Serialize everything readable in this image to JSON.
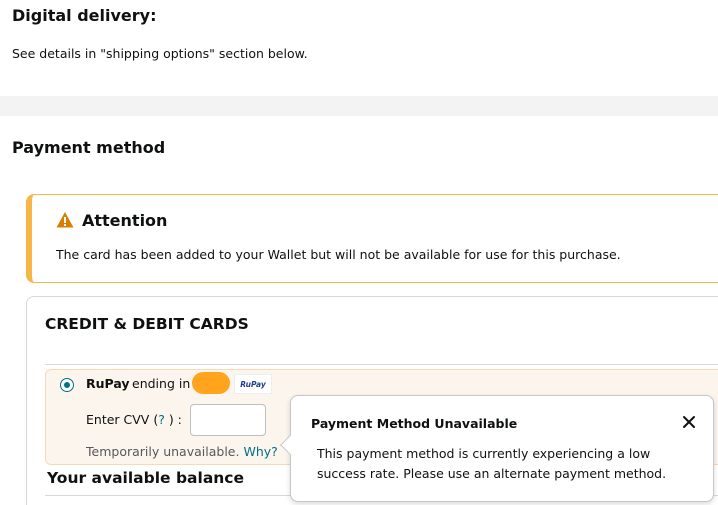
{
  "digital_delivery": {
    "title": "Digital delivery:",
    "description": "See details in \"shipping options\" section below."
  },
  "payment": {
    "title": "Payment method"
  },
  "attention": {
    "icon": "warning-icon",
    "heading": "Attention",
    "message": "The card has been added to your Wallet but will not be available for use for this purchase."
  },
  "cards": {
    "section_title": "CREDIT & DEBIT CARDS",
    "card": {
      "brand": "RuPay",
      "ending_text": "ending in",
      "logo_text": "RuPay",
      "selected": true,
      "cvv_label": "Enter CVV (",
      "cvv_help": "?",
      "cvv_label_end": " ) :",
      "cvv_value": "",
      "unavailable_text": "Temporarily unavailable.",
      "why_link": "Why?"
    },
    "balance_title": "Your available balance"
  },
  "popover": {
    "title": "Payment Method Unavailable",
    "body": "This payment method is currently experiencing a low success rate. Please use an alternate payment method.",
    "close_icon": "close-icon"
  },
  "colors": {
    "accent_link": "#007185",
    "warning": "#f7b748",
    "card_bg": "#fcf5ee",
    "redaction": "#ffa41c"
  }
}
